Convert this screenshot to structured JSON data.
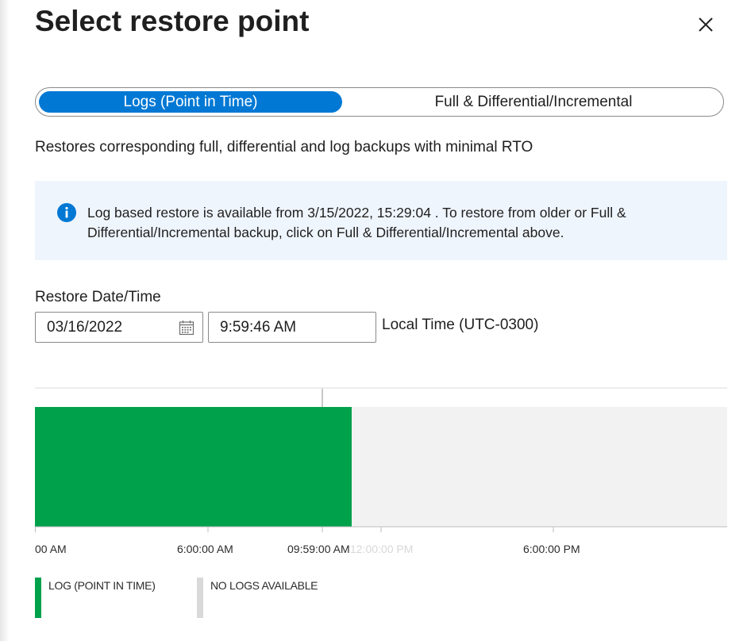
{
  "panel": {
    "title": "Select restore point",
    "close_icon": "close-icon"
  },
  "restore_type_toggle": {
    "options": [
      {
        "label": "Logs (Point in Time)",
        "selected": true
      },
      {
        "label": "Full & Differential/Incremental",
        "selected": false
      }
    ],
    "accent_color": "#0078d4"
  },
  "description": "Restores corresponding full, differential and log backups with minimal RTO",
  "info_banner": {
    "icon": "info-icon",
    "text": "Log based restore is available from 3/15/2022, 15:29:04 . To restore from older or Full & Differential/Incremental backup, click on Full & Differential/Incremental above.",
    "background_color": "#eff5fc"
  },
  "restore_datetime": {
    "label": "Restore Date/Time",
    "date_value": "03/16/2022",
    "date_icon": "calendar-icon",
    "time_value": "9:59:46 AM",
    "timezone_label": "Local Time (UTC-0300)"
  },
  "timeline": {
    "segments": [
      {
        "type": "log",
        "color": "#00a14b"
      },
      {
        "type": "no-logs",
        "color": "#f2f2f2"
      }
    ],
    "tick_labels": [
      {
        "text": "00 AM",
        "faded": false
      },
      {
        "text": "6:00:00 AM",
        "faded": false
      },
      {
        "text": "09:59:00 AM",
        "faded": false
      },
      {
        "text": "12:00:00 PM",
        "faded": true
      },
      {
        "text": "6:00:00 PM",
        "faded": false
      }
    ]
  },
  "legend": [
    {
      "label": "LOG (POINT IN TIME)",
      "color": "#00a14b"
    },
    {
      "label": "NO LOGS AVAILABLE",
      "color": "#d9d9d9"
    }
  ]
}
